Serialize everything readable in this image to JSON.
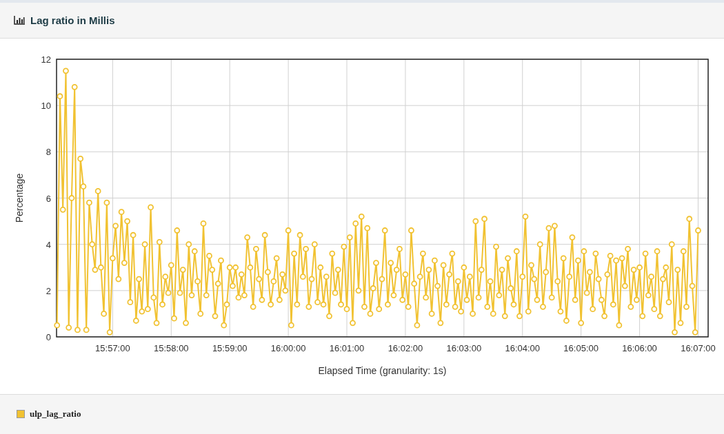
{
  "panel": {
    "title": "Lag ratio in Millis"
  },
  "chart": {
    "chart_data": {
      "type": "line",
      "grid": true,
      "xlabel": "Elapsed Time (granularity: 1s)",
      "ylabel": "Percentage",
      "ylim": [
        0,
        12
      ],
      "yticks": [
        0,
        2,
        4,
        6,
        8,
        10,
        12
      ],
      "categories": [
        null,
        null,
        null,
        null,
        null,
        null,
        null,
        null,
        null,
        null,
        null,
        null,
        null,
        null,
        null,
        null,
        null,
        null,
        null,
        "15:57:00",
        null,
        null,
        null,
        null,
        null,
        null,
        null,
        null,
        null,
        null,
        null,
        null,
        null,
        null,
        null,
        null,
        null,
        null,
        null,
        "15:58:00",
        null,
        null,
        null,
        null,
        null,
        null,
        null,
        null,
        null,
        null,
        null,
        null,
        null,
        null,
        null,
        null,
        null,
        null,
        null,
        "15:59:00",
        null,
        null,
        null,
        null,
        null,
        null,
        null,
        null,
        null,
        null,
        null,
        null,
        null,
        null,
        null,
        null,
        null,
        null,
        null,
        "16:00:00",
        null,
        null,
        null,
        null,
        null,
        null,
        null,
        null,
        null,
        null,
        null,
        null,
        null,
        null,
        null,
        null,
        null,
        null,
        null,
        "16:01:00",
        null,
        null,
        null,
        null,
        null,
        null,
        null,
        null,
        null,
        null,
        null,
        null,
        null,
        null,
        null,
        null,
        null,
        null,
        null,
        "16:02:00",
        null,
        null,
        null,
        null,
        null,
        null,
        null,
        null,
        null,
        null,
        null,
        null,
        null,
        null,
        null,
        null,
        null,
        null,
        null,
        "16:03:00",
        null,
        null,
        null,
        null,
        null,
        null,
        null,
        null,
        null,
        null,
        null,
        null,
        null,
        null,
        null,
        null,
        null,
        null,
        null,
        "16:04:00",
        null,
        null,
        null,
        null,
        null,
        null,
        null,
        null,
        null,
        null,
        null,
        null,
        null,
        null,
        null,
        null,
        null,
        null,
        null,
        "16:05:00",
        null,
        null,
        null,
        null,
        null,
        null,
        null,
        null,
        null,
        null,
        null,
        null,
        null,
        null,
        null,
        null,
        null,
        null,
        null,
        "16:06:00",
        null,
        null,
        null,
        null,
        null,
        null,
        null,
        null,
        null,
        null,
        null,
        null,
        null,
        null,
        null,
        null,
        null,
        null,
        null,
        "16:07:00"
      ],
      "series": [
        {
          "name": "ulp_lag_ratio",
          "color": "#f1c232",
          "marker": "circle",
          "values": [
            0.5,
            10.4,
            5.5,
            11.5,
            0.4,
            6.0,
            10.8,
            0.3,
            7.7,
            6.5,
            0.3,
            5.8,
            4.0,
            2.9,
            6.3,
            3.0,
            1.0,
            5.8,
            0.2,
            3.4,
            4.8,
            2.5,
            5.4,
            3.2,
            5.0,
            1.5,
            4.4,
            0.7,
            2.5,
            1.1,
            4.0,
            1.2,
            5.6,
            1.7,
            0.6,
            4.1,
            1.4,
            2.6,
            1.9,
            3.1,
            0.8,
            4.6,
            1.9,
            2.9,
            0.6,
            4.0,
            1.8,
            3.7,
            2.4,
            1.0,
            4.9,
            1.8,
            3.5,
            2.9,
            0.9,
            2.3,
            3.3,
            0.5,
            1.4,
            3.0,
            2.2,
            3.0,
            1.7,
            2.7,
            1.8,
            4.3,
            3.0,
            1.3,
            3.8,
            2.5,
            1.6,
            4.4,
            2.8,
            1.4,
            2.4,
            3.4,
            1.6,
            2.7,
            2.0,
            4.6,
            0.5,
            3.6,
            1.4,
            4.4,
            2.6,
            3.8,
            1.3,
            2.5,
            4.0,
            1.5,
            3.0,
            1.4,
            2.6,
            0.9,
            3.6,
            1.9,
            2.9,
            1.4,
            3.9,
            1.2,
            4.3,
            0.6,
            4.9,
            2.0,
            5.2,
            1.3,
            4.7,
            1.0,
            2.1,
            3.2,
            1.2,
            2.5,
            4.6,
            1.4,
            3.2,
            1.8,
            2.9,
            3.8,
            1.6,
            2.7,
            1.3,
            4.6,
            2.3,
            0.5,
            2.6,
            3.6,
            1.7,
            2.9,
            1.0,
            3.3,
            2.2,
            0.6,
            3.1,
            1.4,
            2.7,
            3.6,
            1.3,
            2.4,
            1.1,
            3.0,
            1.6,
            2.6,
            1.0,
            5.0,
            1.7,
            2.9,
            5.1,
            1.3,
            2.4,
            1.0,
            3.9,
            1.8,
            2.9,
            0.9,
            3.4,
            2.1,
            1.4,
            3.7,
            0.9,
            2.6,
            5.2,
            1.1,
            3.1,
            2.5,
            1.6,
            4.0,
            1.3,
            2.8,
            4.7,
            1.7,
            4.8,
            2.4,
            1.1,
            3.4,
            0.7,
            2.6,
            4.3,
            1.6,
            3.3,
            0.6,
            3.7,
            1.9,
            2.8,
            1.2,
            3.6,
            2.5,
            1.6,
            0.9,
            2.7,
            3.5,
            1.4,
            3.3,
            0.5,
            3.4,
            2.2,
            3.8,
            1.3,
            2.9,
            1.6,
            3.0,
            0.9,
            3.6,
            1.8,
            2.6,
            1.2,
            3.7,
            0.9,
            2.5,
            3.0,
            1.5,
            4.0,
            0.2,
            2.9,
            0.6,
            3.7,
            1.3,
            5.1,
            2.2,
            0.2,
            4.6
          ]
        }
      ]
    }
  }
}
